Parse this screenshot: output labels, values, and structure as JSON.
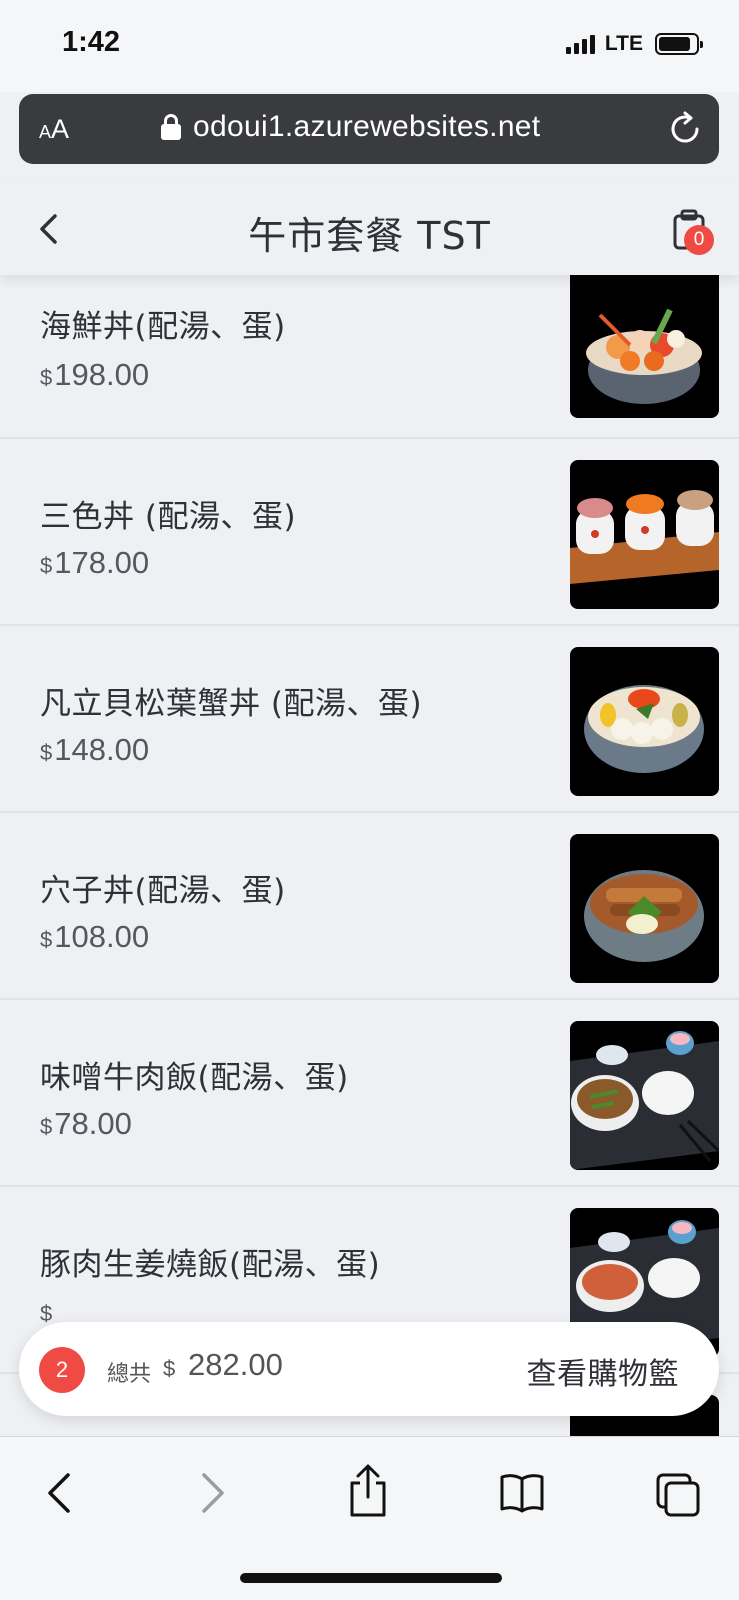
{
  "status": {
    "time": "1:42",
    "network": "LTE"
  },
  "browser": {
    "aa_small": "A",
    "aa_big": "A",
    "domain": "odoui1.azurewebsites.net"
  },
  "header": {
    "title": "午市套餐 TST",
    "cart_count": "0"
  },
  "menu": {
    "currency": "$",
    "items": [
      {
        "name": "海鮮丼(配湯、蛋)",
        "price": "198.00"
      },
      {
        "name": "三色丼 (配湯、蛋)",
        "price": "178.00"
      },
      {
        "name": "凡立貝松葉蟹丼 (配湯、蛋)",
        "price": "148.00"
      },
      {
        "name": "穴子丼(配湯、蛋)",
        "price": "108.00"
      },
      {
        "name": "味噌牛肉飯(配湯、蛋)",
        "price": "78.00"
      },
      {
        "name": "豚肉生姜燒飯(配湯、蛋)",
        "price": ""
      }
    ]
  },
  "cart_summary": {
    "count": "2",
    "total_label": "總共",
    "currency": "$",
    "total": "282.00",
    "view_cart_label": "查看購物籃"
  },
  "colors": {
    "accent": "#f04a44",
    "background": "#eef0f4",
    "text": "#2f3137"
  }
}
